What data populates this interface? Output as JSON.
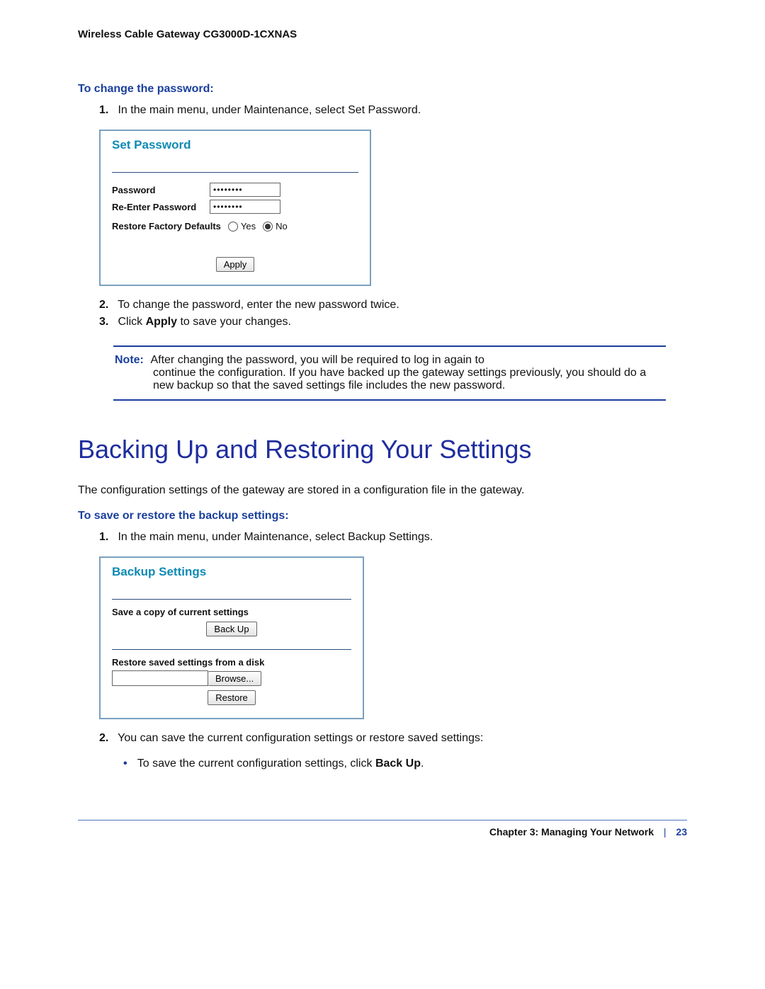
{
  "doc": {
    "product_title": "Wireless Cable Gateway CG3000D-1CXNAS"
  },
  "password_section": {
    "title": "To change the password:",
    "steps": {
      "s1": "In the main menu, under Maintenance, select Set Password.",
      "s2": "To change the password, enter the new password twice.",
      "s3_pre": "Click ",
      "s3_bold": "Apply",
      "s3_post": " to save your changes."
    },
    "panel": {
      "title": "Set Password",
      "pw_label": "Password",
      "pw_value": "••••••••",
      "pw2_label": "Re-Enter Password",
      "pw2_value": "••••••••",
      "restore_label": "Restore Factory Defaults",
      "yes": "Yes",
      "no": "No",
      "apply_btn": "Apply"
    },
    "note": {
      "label": "Note:",
      "text": "After changing the password, you will be required to log in again to continue the configuration. If you have backed up the gateway settings previously, you should do a new backup so that the saved settings file includes the new password."
    }
  },
  "backup_section": {
    "heading": "Backing Up and Restoring Your Settings",
    "intro": "The configuration settings of the gateway are stored in a configuration file in the gateway.",
    "subtitle": "To save or restore the backup settings:",
    "steps": {
      "s1": "In the main menu, under Maintenance, select Backup Settings.",
      "s2": "You can save the current configuration settings or restore saved settings:",
      "bullet_pre": "To save the current configuration settings, click ",
      "bullet_bold": "Back Up",
      "bullet_post": "."
    },
    "panel": {
      "title": "Backup Settings",
      "save_label": "Save a copy of current settings",
      "backup_btn": "Back Up",
      "restore_label": "Restore saved settings from a disk",
      "browse_btn": "Browse...",
      "restore_btn": "Restore"
    }
  },
  "footer": {
    "chapter": "Chapter 3:  Managing Your Network",
    "page": "23"
  }
}
